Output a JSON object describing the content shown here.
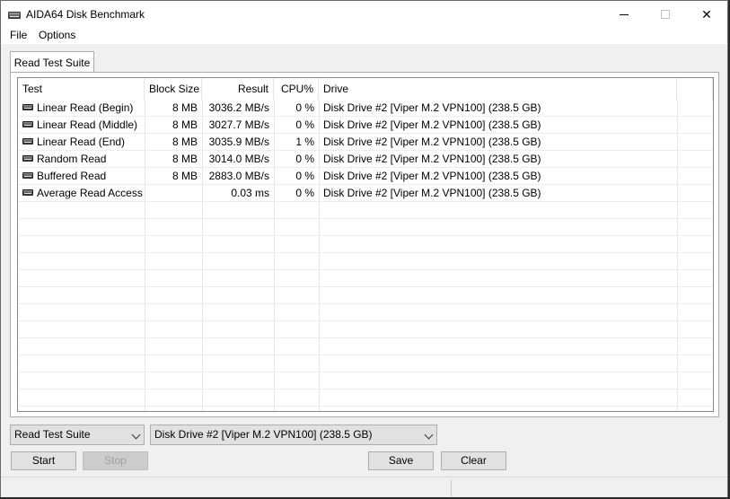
{
  "window": {
    "title": "AIDA64 Disk Benchmark"
  },
  "menu": {
    "file": "File",
    "options": "Options"
  },
  "tabs": [
    {
      "label": "Read Test Suite"
    }
  ],
  "table": {
    "columns": [
      "Test",
      "Block Size",
      "Result",
      "CPU%",
      "Drive"
    ],
    "rows": [
      {
        "test": "Linear Read (Begin)",
        "block_size": "8 MB",
        "result": "3036.2 MB/s",
        "cpu": "0 %",
        "drive": "Disk Drive #2  [Viper M.2 VPN100]  (238.5 GB)"
      },
      {
        "test": "Linear Read (Middle)",
        "block_size": "8 MB",
        "result": "3027.7 MB/s",
        "cpu": "0 %",
        "drive": "Disk Drive #2  [Viper M.2 VPN100]  (238.5 GB)"
      },
      {
        "test": "Linear Read (End)",
        "block_size": "8 MB",
        "result": "3035.9 MB/s",
        "cpu": "1 %",
        "drive": "Disk Drive #2  [Viper M.2 VPN100]  (238.5 GB)"
      },
      {
        "test": "Random Read",
        "block_size": "8 MB",
        "result": "3014.0 MB/s",
        "cpu": "0 %",
        "drive": "Disk Drive #2  [Viper M.2 VPN100]  (238.5 GB)"
      },
      {
        "test": "Buffered Read",
        "block_size": "8 MB",
        "result": "2883.0 MB/s",
        "cpu": "0 %",
        "drive": "Disk Drive #2  [Viper M.2 VPN100]  (238.5 GB)"
      },
      {
        "test": "Average Read Access",
        "block_size": "",
        "result": "0.03 ms",
        "cpu": "0 %",
        "drive": "Disk Drive #2  [Viper M.2 VPN100]  (238.5 GB)"
      }
    ]
  },
  "controls": {
    "suite_select": "Read Test Suite",
    "drive_select": "Disk Drive #2  [Viper M.2 VPN100]  (238.5 GB)",
    "start_label": "Start",
    "stop_label": "Stop",
    "save_label": "Save",
    "clear_label": "Clear"
  },
  "icons": {
    "app": "disk-drive-icon",
    "row": "disk-drive-icon"
  }
}
